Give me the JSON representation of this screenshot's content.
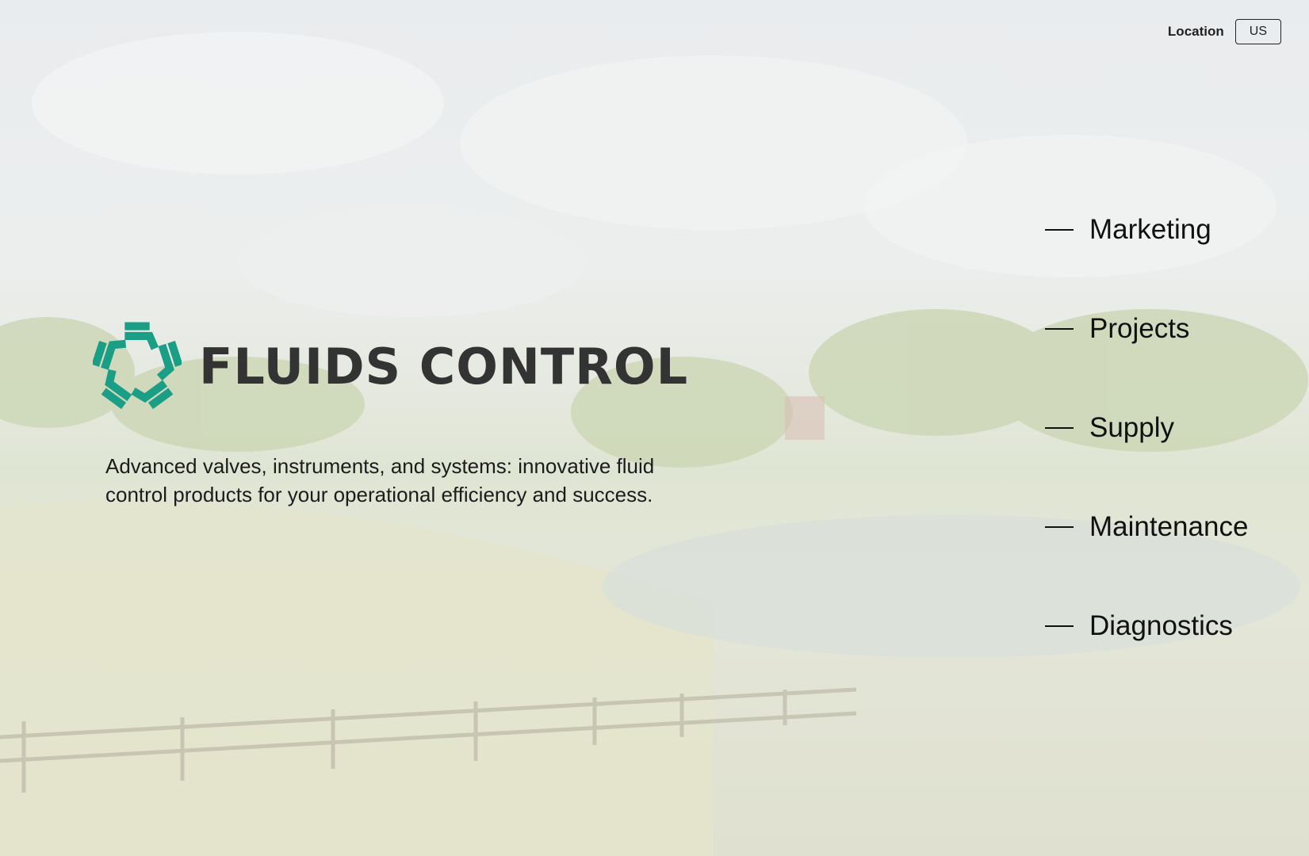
{
  "header": {
    "location_label": "Location",
    "location_value": "US"
  },
  "brand": {
    "name": "FLUIDS CONTROL",
    "logo_icon": "pentagon-star-logo-icon",
    "accent_color": "#1a9e86",
    "text_color": "#333333"
  },
  "hero": {
    "tagline": "Advanced valves, instruments, and systems: innovative fluid control products for your operational efficiency and success."
  },
  "nav": {
    "items": [
      {
        "label": "Marketing"
      },
      {
        "label": "Projects"
      },
      {
        "label": "Supply"
      },
      {
        "label": "Maintenance"
      },
      {
        "label": "Diagnostics"
      }
    ]
  }
}
